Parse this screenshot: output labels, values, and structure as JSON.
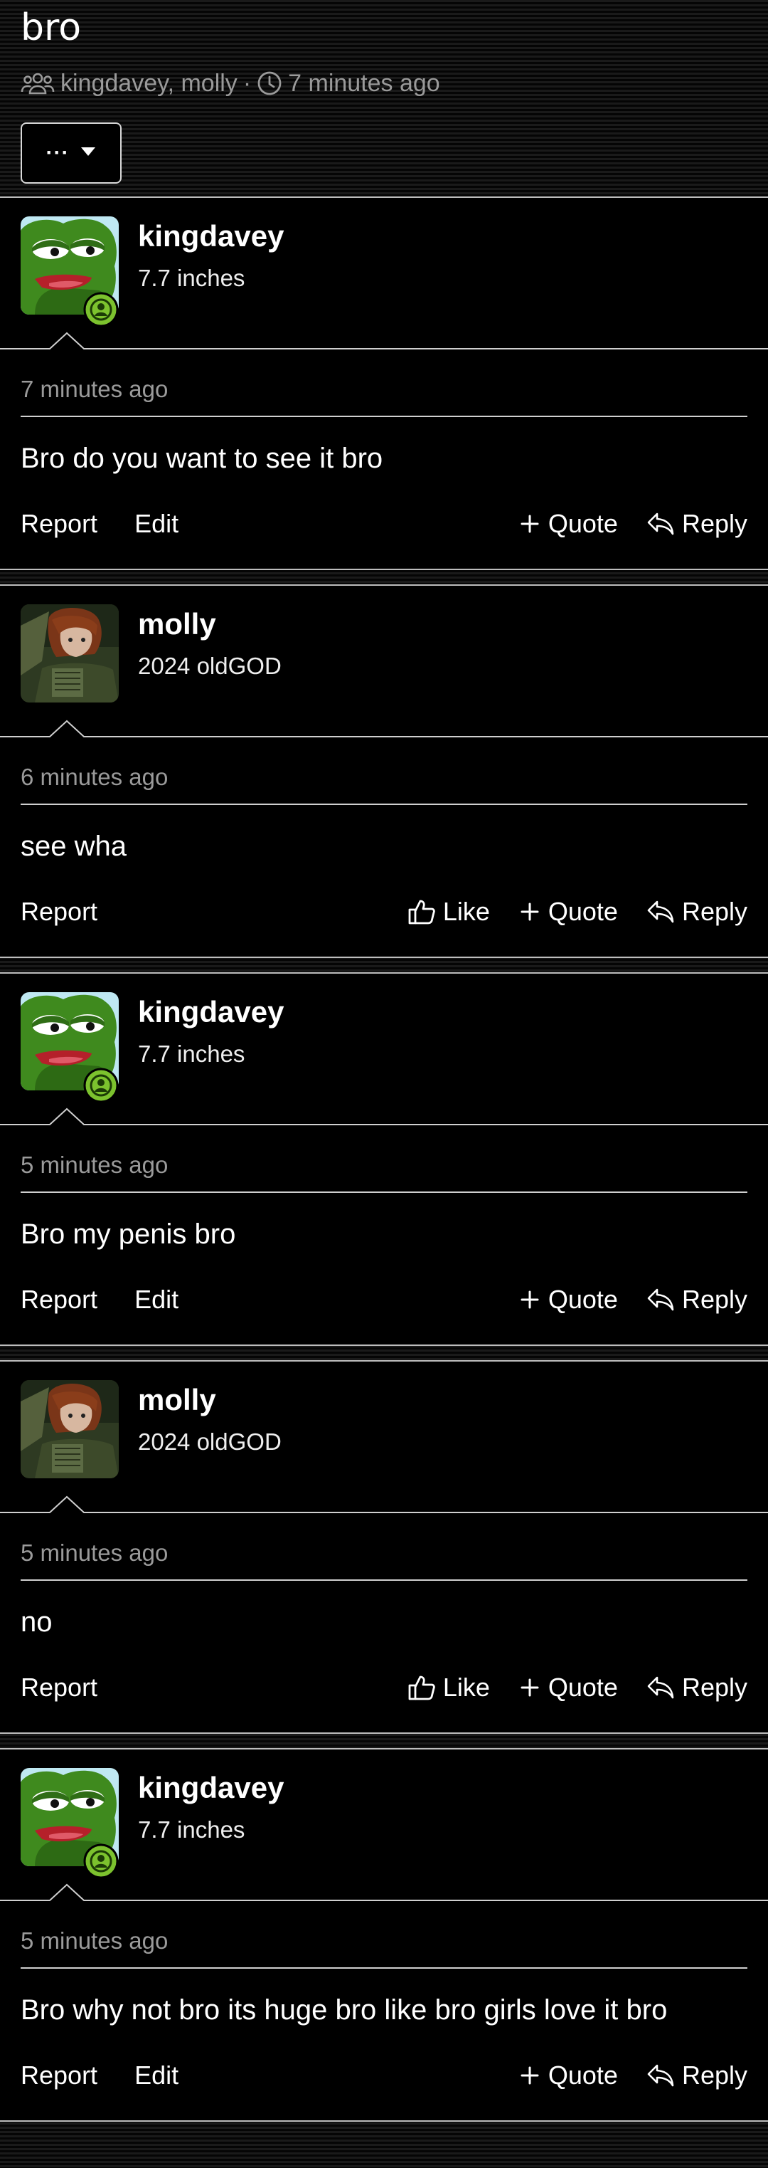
{
  "thread": {
    "title": "bro",
    "participants": "kingdavey, molly",
    "separator": "·",
    "time": "7 minutes ago"
  },
  "menu": {
    "label": "···"
  },
  "posts": [
    {
      "username": "kingdavey",
      "user_title": "7.7 inches",
      "timestamp": "7 minutes ago",
      "body": "Bro do you want to see it bro",
      "report": "Report",
      "edit": "Edit",
      "quote": "Quote",
      "reply": "Reply"
    },
    {
      "username": "molly",
      "user_title": "2024 oldGOD",
      "timestamp": "6 minutes ago",
      "body": "see wha",
      "report": "Report",
      "like": "Like",
      "quote": "Quote",
      "reply": "Reply"
    },
    {
      "username": "kingdavey",
      "user_title": "7.7 inches",
      "timestamp": "5 minutes ago",
      "body": "Bro my penis bro",
      "report": "Report",
      "edit": "Edit",
      "quote": "Quote",
      "reply": "Reply"
    },
    {
      "username": "molly",
      "user_title": "2024 oldGOD",
      "timestamp": "5 minutes ago",
      "body": "no",
      "report": "Report",
      "like": "Like",
      "quote": "Quote",
      "reply": "Reply"
    },
    {
      "username": "kingdavey",
      "user_title": "7.7 inches",
      "timestamp": "5 minutes ago",
      "body": "Bro why not bro its huge bro like bro girls love it bro",
      "report": "Report",
      "edit": "Edit",
      "quote": "Quote",
      "reply": "Reply"
    }
  ],
  "icons": {
    "participants": "users-icon",
    "time": "clock-icon",
    "menu_caret": "caret-down-icon",
    "like": "thumbs-up-icon",
    "quote": "plus-icon",
    "reply": "reply-icon",
    "online": "user-online-badge-icon"
  },
  "colors": {
    "online_badge": "#7cc22e",
    "muted_text": "#9a9a9a"
  }
}
